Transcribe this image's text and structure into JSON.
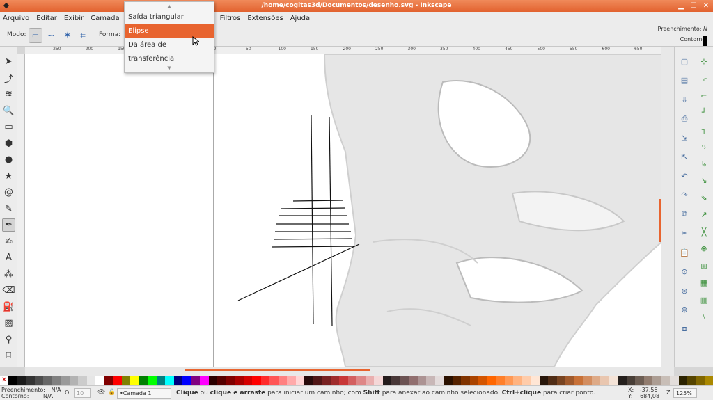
{
  "window": {
    "title": "/home/cogitas3d/Documentos/desenho.svg - Inkscape"
  },
  "menu": [
    "Arquivo",
    "Editar",
    "Exibir",
    "Camada",
    "Filtros",
    "Extensões",
    "Ajuda"
  ],
  "toolcontrols": {
    "mode_label": "Modo:",
    "shape_label": "Forma:"
  },
  "shape_dropdown": {
    "items": [
      "Saída triangular",
      "Elipse",
      "Da área de transferência"
    ],
    "selected": "Elipse"
  },
  "fill_indicator": {
    "fill_label": "Preenchimento:",
    "fill_value": "N",
    "stroke_label": "Contorno:"
  },
  "ruler_labels": [
    "-250",
    "-200",
    "-150",
    "-100",
    "-50",
    "0",
    "50",
    "100",
    "150",
    "200",
    "250",
    "300",
    "350",
    "400",
    "450",
    "500",
    "550",
    "600",
    "650"
  ],
  "tools": [
    "selector-icon",
    "node-icon",
    "tweak-icon",
    "zoom-icon",
    "rect-icon",
    "box3d-icon",
    "ellipse-icon",
    "star-icon",
    "spiral-icon",
    "pencil-icon",
    "pen-icon",
    "calligraphy-icon",
    "text-icon",
    "spray-icon",
    "eraser-icon",
    "bucket-icon",
    "gradient-icon",
    "dropper-icon",
    "connector-icon"
  ],
  "palette_colors": [
    "#000000",
    "#1a1a1a",
    "#333333",
    "#4d4d4d",
    "#666666",
    "#808080",
    "#999999",
    "#b3b3b3",
    "#cccccc",
    "#e6e6e6",
    "#ffffff",
    "#800000",
    "#ff0000",
    "#808000",
    "#ffff00",
    "#008000",
    "#00ff00",
    "#008080",
    "#00ffff",
    "#000080",
    "#0000ff",
    "#800080",
    "#ff00ff",
    "#2b0000",
    "#550000",
    "#800000",
    "#aa0000",
    "#d40000",
    "#ff0000",
    "#ff2a2a",
    "#ff5555",
    "#ff8080",
    "#ffaaaa",
    "#ffd5d5",
    "#280b0b",
    "#501616",
    "#782121",
    "#a02c2c",
    "#c83737",
    "#d35f5f",
    "#de8787",
    "#e9afaf",
    "#f4d7d7",
    "#241c1c",
    "#483737",
    "#6c5353",
    "#916f6f",
    "#ac9393",
    "#c8b7b7",
    "#e3dbdb",
    "#2b1100",
    "#552200",
    "#803300",
    "#aa4400",
    "#d45500",
    "#ff6600",
    "#ff7f2a",
    "#ff9955",
    "#ffb380",
    "#ffccaa",
    "#ffe6d5",
    "#28170b",
    "#502d16",
    "#784421",
    "#a05a2c",
    "#c87137",
    "#d38d5f",
    "#deaa87",
    "#e9c6af",
    "#f4e3d7",
    "#241f1c",
    "#483e37",
    "#6c5d53",
    "#917c6f",
    "#ac9d93",
    "#c8beb7",
    "#e3dedb",
    "#2b2200",
    "#554400",
    "#806600",
    "#aa8800"
  ],
  "status": {
    "fill_label": "Preenchimento:",
    "fill_value": "N/A",
    "stroke_label": "Contorno:",
    "stroke_value": "N/A",
    "opacity_label": "O:",
    "opacity_value": "10",
    "layer": "•Camada 1",
    "message_b1": "Clique",
    "message_t1": " ou ",
    "message_b2": "clique e arraste",
    "message_t2": " para iniciar um caminho; com ",
    "message_b3": "Shift",
    "message_t3": " para anexar ao caminho selecionado. ",
    "message_b4": "Ctrl+clique",
    "message_t4": " para criar ponto.",
    "x_label": "X:",
    "x_value": "-37,56",
    "y_label": "Y:",
    "y_value": "684,08",
    "zoom_label": "Z:",
    "zoom_value": "125%"
  }
}
